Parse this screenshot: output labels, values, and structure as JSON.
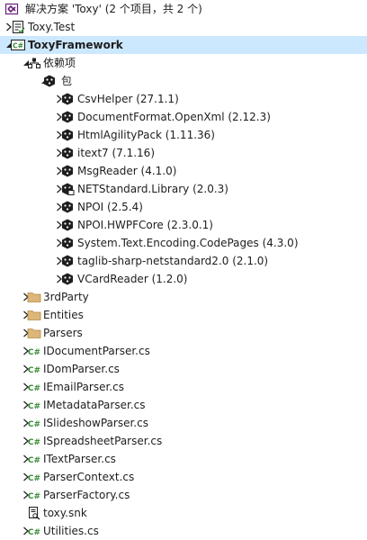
{
  "solution": {
    "label": "解决方案 'Toxy' (2 个项目，共 2 个)",
    "icon": "solution-icon"
  },
  "nodes": [
    {
      "id": "toxy-test",
      "label": "Toxy.Test",
      "level": 0,
      "expander": "collapsed",
      "icon": "test-project-icon"
    },
    {
      "id": "toxyframework",
      "label": "ToxyFramework",
      "level": 0,
      "expander": "expanded",
      "icon": "csharp-project-icon",
      "selected": true
    },
    {
      "id": "dependencies",
      "label": "依赖项",
      "level": 1,
      "expander": "expanded",
      "icon": "dependencies-icon"
    },
    {
      "id": "packages",
      "label": "包",
      "level": 2,
      "expander": "expanded",
      "icon": "package-icon"
    },
    {
      "id": "pkg-csvhelper",
      "label": "CsvHelper (27.1.1)",
      "level": 3,
      "expander": "collapsed",
      "icon": "package-icon"
    },
    {
      "id": "pkg-documentformat",
      "label": "DocumentFormat.OpenXml (2.12.3)",
      "level": 3,
      "expander": "collapsed",
      "icon": "package-icon"
    },
    {
      "id": "pkg-htmlagilitypack",
      "label": "HtmlAgilityPack (1.11.36)",
      "level": 3,
      "expander": "collapsed",
      "icon": "package-icon"
    },
    {
      "id": "pkg-itext7",
      "label": "itext7 (7.1.16)",
      "level": 3,
      "expander": "collapsed",
      "icon": "package-icon"
    },
    {
      "id": "pkg-msgreader",
      "label": "MsgReader (4.1.0)",
      "level": 3,
      "expander": "collapsed",
      "icon": "package-icon"
    },
    {
      "id": "pkg-netstandard",
      "label": "NETStandard.Library (2.0.3)",
      "level": 3,
      "expander": "collapsed",
      "icon": "package-locked-icon"
    },
    {
      "id": "pkg-npoi",
      "label": "NPOI (2.5.4)",
      "level": 3,
      "expander": "collapsed",
      "icon": "package-icon"
    },
    {
      "id": "pkg-npoi-hwpf",
      "label": "NPOI.HWPFCore (2.3.0.1)",
      "level": 3,
      "expander": "collapsed",
      "icon": "package-icon"
    },
    {
      "id": "pkg-system-text",
      "label": "System.Text.Encoding.CodePages (4.3.0)",
      "level": 3,
      "expander": "collapsed",
      "icon": "package-icon"
    },
    {
      "id": "pkg-taglib",
      "label": "taglib-sharp-netstandard2.0 (2.1.0)",
      "level": 3,
      "expander": "collapsed",
      "icon": "package-icon"
    },
    {
      "id": "pkg-vcardreader",
      "label": "VCardReader (1.2.0)",
      "level": 3,
      "expander": "collapsed",
      "icon": "package-icon"
    },
    {
      "id": "folder-3rdparty",
      "label": "3rdParty",
      "level": 1,
      "expander": "collapsed",
      "icon": "folder-icon"
    },
    {
      "id": "folder-entities",
      "label": "Entities",
      "level": 1,
      "expander": "collapsed",
      "icon": "folder-icon"
    },
    {
      "id": "folder-parsers",
      "label": "Parsers",
      "level": 1,
      "expander": "collapsed",
      "icon": "folder-icon"
    },
    {
      "id": "file-idocumentparser",
      "label": "IDocumentParser.cs",
      "level": 1,
      "expander": "collapsed",
      "icon": "csharp-file-icon"
    },
    {
      "id": "file-idomparser",
      "label": "IDomParser.cs",
      "level": 1,
      "expander": "collapsed",
      "icon": "csharp-file-icon"
    },
    {
      "id": "file-iemailparser",
      "label": "IEmailParser.cs",
      "level": 1,
      "expander": "collapsed",
      "icon": "csharp-file-icon"
    },
    {
      "id": "file-imetadataparser",
      "label": "IMetadataParser.cs",
      "level": 1,
      "expander": "collapsed",
      "icon": "csharp-file-icon"
    },
    {
      "id": "file-islideshowparser",
      "label": "ISlideshowParser.cs",
      "level": 1,
      "expander": "collapsed",
      "icon": "csharp-file-icon"
    },
    {
      "id": "file-ispreadsheetparser",
      "label": "ISpreadsheetParser.cs",
      "level": 1,
      "expander": "collapsed",
      "icon": "csharp-file-icon"
    },
    {
      "id": "file-itextparser",
      "label": "ITextParser.cs",
      "level": 1,
      "expander": "collapsed",
      "icon": "csharp-file-icon"
    },
    {
      "id": "file-parsercontext",
      "label": "ParserContext.cs",
      "level": 1,
      "expander": "collapsed",
      "icon": "csharp-file-icon"
    },
    {
      "id": "file-parserfactory",
      "label": "ParserFactory.cs",
      "level": 1,
      "expander": "collapsed",
      "icon": "csharp-file-icon"
    },
    {
      "id": "file-toxysnk",
      "label": "toxy.snk",
      "level": 1,
      "expander": "none",
      "icon": "key-file-icon"
    },
    {
      "id": "file-utilities",
      "label": "Utilities.cs",
      "level": 1,
      "expander": "collapsed",
      "icon": "csharp-file-icon"
    }
  ],
  "colors": {
    "selection": "#cce8ff",
    "folder": "#dcb67a",
    "csharp": "#388a34",
    "package": "#1e1e1e",
    "expander": "#1e1e1e"
  }
}
